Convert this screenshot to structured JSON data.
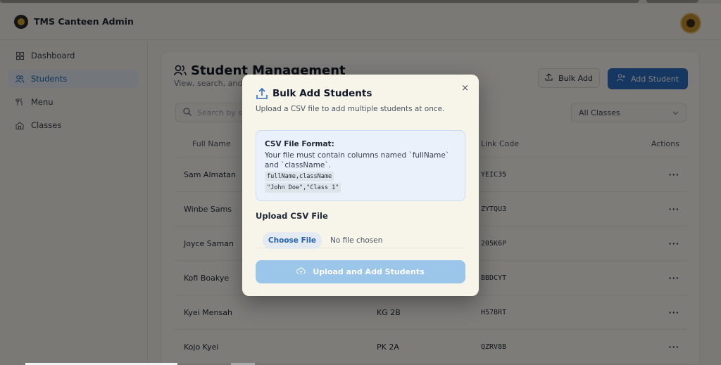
{
  "header": {
    "app_title": "TMS Canteen Admin"
  },
  "sidebar": {
    "items": [
      {
        "label": "Dashboard",
        "icon": "grid-icon"
      },
      {
        "label": "Students",
        "icon": "users-icon",
        "active": true
      },
      {
        "label": "Menu",
        "icon": "utensils-icon"
      },
      {
        "label": "Classes",
        "icon": "school-icon"
      }
    ]
  },
  "main": {
    "title": "Student Management",
    "subtitle": "View, search, and s",
    "bulk_add_label": "Bulk Add",
    "add_student_label": "Add Student",
    "search_placeholder": "Search by st",
    "class_filter_value": "All Classes",
    "columns": {
      "name": "Full Name",
      "code": "Link Code",
      "actions": "Actions"
    },
    "rows": [
      {
        "name": "Sam Almatan",
        "class": "",
        "code": "YEIC35"
      },
      {
        "name": "Winbe Sams",
        "class": "",
        "code": "ZYTQU3"
      },
      {
        "name": "Joyce Saman",
        "class": "",
        "code": "205K6P"
      },
      {
        "name": "Kofi Boakye",
        "class": "",
        "code": "BBDCYT"
      },
      {
        "name": "Kyei Mensah",
        "class": "KG 2B",
        "code": "H57BRT"
      },
      {
        "name": "Kojo Kyei",
        "class": "PK 2A",
        "code": "QZRV8B"
      }
    ]
  },
  "modal": {
    "title": "Bulk Add Students",
    "close": "×",
    "description": "Upload a CSV file to add multiple students at once.",
    "format_title": "CSV File Format:",
    "format_desc": "Your file must contain columns named `fullName` and `className`.",
    "code_line1": "fullName,className",
    "code_line2": "\"John Doe\",\"Class 1\"",
    "upload_label": "Upload CSV File",
    "choose_file": "Choose File",
    "no_file": "No file chosen",
    "submit": "Upload and Add Students"
  },
  "colors": {
    "accent": "#2b6fc3",
    "active_nav_bg": "#e7eef6",
    "modal_bg": "#f7f4ea",
    "submit_disabled": "#9cc5ea"
  }
}
